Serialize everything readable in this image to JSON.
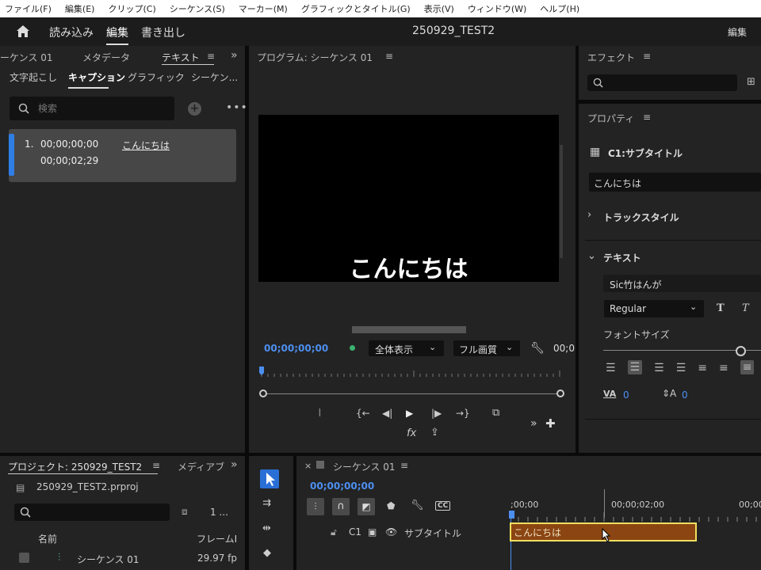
{
  "menu": [
    "ファイル(F)",
    "編集(E)",
    "クリップ(C)",
    "シーケンス(S)",
    "マーカー(M)",
    "グラフィックとタイトル(G)",
    "表示(V)",
    "ウィンドウ(W)",
    "ヘルプ(H)"
  ],
  "titlebar": {
    "import": "読み込み",
    "edit": "編集",
    "export": "書き出し",
    "project": "250929_TEST2",
    "workspace": "編集"
  },
  "left": {
    "tab_seq": "ーケンス 01",
    "tab_meta": "メタデータ",
    "tab_text": "テキスト",
    "sub_transcribe": "文字起こし",
    "sub_caption": "キャプション",
    "sub_graphic": "グラフィック",
    "sub_seq": "シーケン...",
    "search_placeholder": "検索",
    "caption": {
      "num": "1.",
      "in": "00;00;00;00",
      "out": "00;00;02;29",
      "text": "こんにちは"
    }
  },
  "program": {
    "title": "プログラム: シーケンス 01",
    "caption_text": "こんにちは",
    "timecode": "00;00;00;00",
    "zoom": "全体表示",
    "quality": "フル画質",
    "end_tc": "00;0"
  },
  "effects": {
    "title": "エフェクト"
  },
  "properties": {
    "title": "プロパティ",
    "clip": "C1:サブタイトル",
    "text_value": "こんにちは",
    "track_style": "トラックスタイル",
    "text_section": "テキスト",
    "font": "Sic竹はんが",
    "style": "Regular",
    "font_size_label": "フォントサイズ",
    "font_size_slider": 0.9,
    "tracking": "0",
    "leading": "0"
  },
  "project": {
    "tab": "プロジェクト: 250929_TEST2",
    "tab2": "メディアブ",
    "file": "250929_TEST2.prproj",
    "count": "1 ...",
    "col_name": "名前",
    "col_fps": "フレームI",
    "item_name": "シーケンス 01",
    "item_fps": "29.97 fp"
  },
  "timeline": {
    "title": "シーケンス 01",
    "timecode": "00;00;00;00",
    "tick0": ";00;00",
    "tick1": "00;00;02;00",
    "tick2": "00;00",
    "track": "C1",
    "track_name": "サブタイトル",
    "clip_text": "こんにちは"
  },
  "colors": {
    "accent": "#4a90e2",
    "clip": "#8b4513",
    "clip_border": "#f0e060",
    "timecode": "#4d8ff0"
  }
}
